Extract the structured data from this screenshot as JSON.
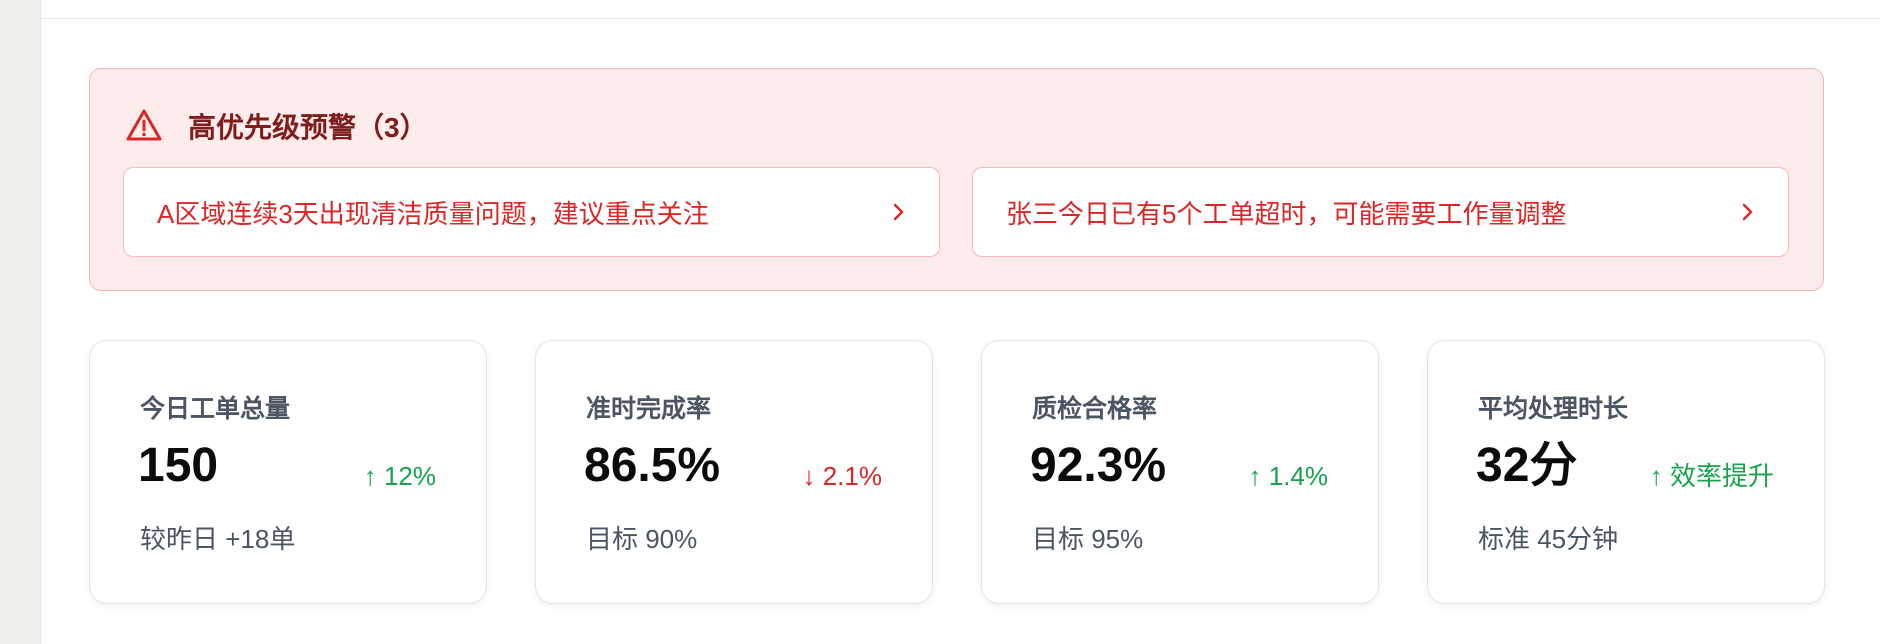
{
  "alert": {
    "title": "高优先级预警（3）",
    "icon": "warning-triangle-icon",
    "items": [
      {
        "text": "A区域连续3天出现清洁质量问题，建议重点关注",
        "icon": "chevron-right-icon"
      },
      {
        "text": "张三今日已有5个工单超时，可能需要工作量调整",
        "icon": "chevron-right-icon"
      }
    ]
  },
  "stats": [
    {
      "title": "今日工单总量",
      "value": "150",
      "trend": "↑ 12%",
      "trend_direction": "up",
      "subtitle": "较昨日 +18单"
    },
    {
      "title": "准时完成率",
      "value": "86.5%",
      "trend": "↓ 2.1%",
      "trend_direction": "down",
      "subtitle": "目标 90%"
    },
    {
      "title": "质检合格率",
      "value": "92.3%",
      "trend": "↑ 1.4%",
      "trend_direction": "up",
      "subtitle": "目标 95%"
    },
    {
      "title": "平均处理时长",
      "value": "32分",
      "trend": "↑ 效率提升",
      "trend_direction": "up",
      "subtitle": "标准 45分钟"
    }
  ],
  "colors": {
    "alert_title": "#7f1d1d",
    "alert_text": "#dc2626",
    "alert_bg": "#fdecec",
    "trend_up": "#16a34a",
    "trend_down": "#dc2626"
  }
}
